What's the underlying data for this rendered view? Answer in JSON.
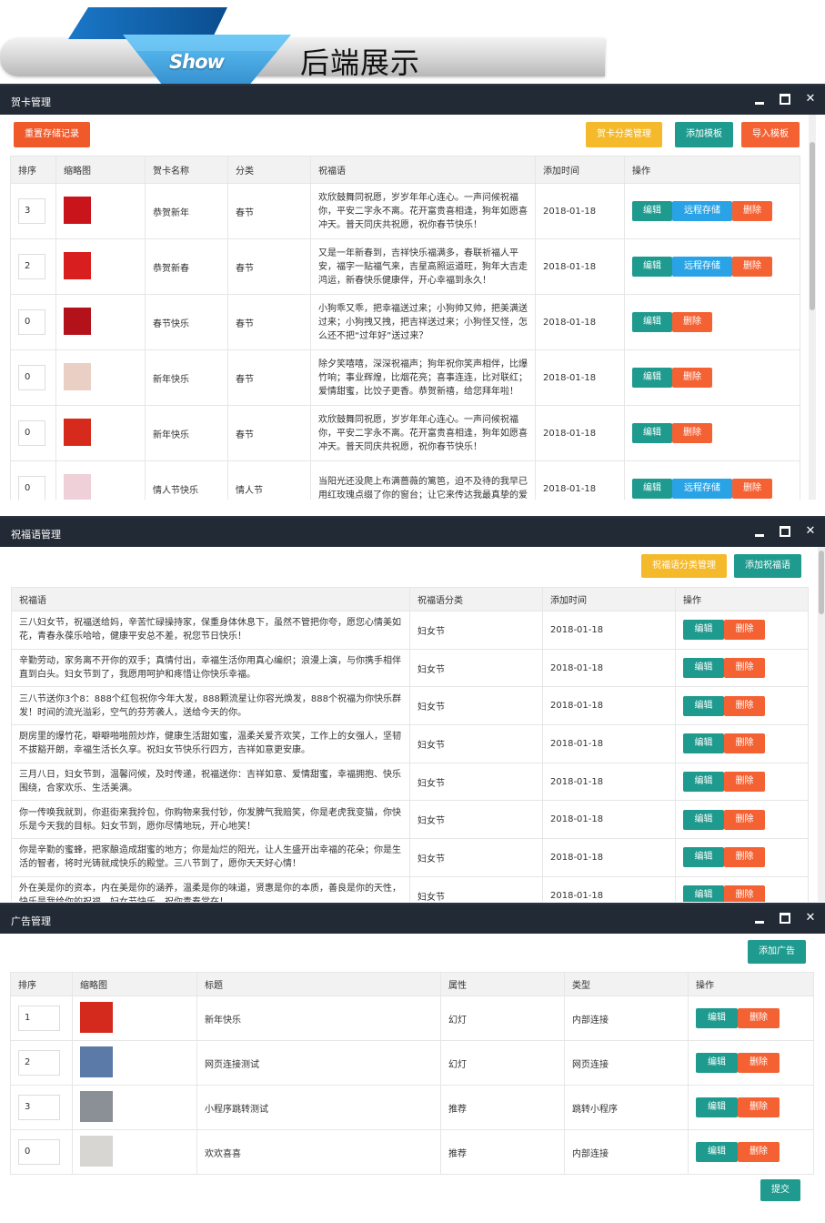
{
  "banner": {
    "show_text": "Show",
    "title": "后端展示"
  },
  "card_panel": {
    "title": "贺卡管理",
    "reset_button": "重置存储记录",
    "category_button": "贺卡分类管理",
    "add_template_button": "添加模板",
    "import_template_button": "导入模板",
    "columns": [
      "排序",
      "缩略图",
      "贺卡名称",
      "分类",
      "祝福语",
      "添加时间",
      "操作"
    ],
    "ops": {
      "edit": "编辑",
      "remote": "远程存储",
      "delete": "删除"
    },
    "rows": [
      {
        "sort": "3",
        "thumb": "#c8141a",
        "name": "恭贺新年",
        "category": "春节",
        "blessing": "欢欣鼓舞同祝愿，岁岁年年心连心。一声问候祝福你，平安二字永不离。花开富贵喜相逢，狗年如愿喜冲天。普天同庆共祝愿，祝你春节快乐！",
        "time": "2018-01-18",
        "remote": true
      },
      {
        "sort": "2",
        "thumb": "#d81e1e",
        "name": "恭贺新春",
        "category": "春节",
        "blessing": "又是一年新春到，吉祥快乐福满多，春联祈福人平安，福字一贴福气来，吉星高照运道旺，狗年大吉走鸿运，新春快乐健康伴，开心幸福到永久！",
        "time": "2018-01-18",
        "remote": true
      },
      {
        "sort": "0",
        "thumb": "#b3121b",
        "name": "春节快乐",
        "category": "春节",
        "blessing": "小狗乖又乖，把幸福送过来；小狗帅又帅，把美满送过来；小狗拽又拽，把吉祥送过来；小狗怪又怪，怎么还不把“过年好”送过来？",
        "time": "2018-01-18",
        "remote": false
      },
      {
        "sort": "0",
        "thumb": "#e9cfc4",
        "name": "新年快乐",
        "category": "春节",
        "blessing": "除夕笑嘻嘻，深深祝福声；狗年祝你笑声相伴，比爆竹响；事业辉煌，比烟花亮；喜事连连，比对联红；爱情甜蜜，比饺子更香。恭贺新禧，给您拜年啦！",
        "time": "2018-01-18",
        "remote": false
      },
      {
        "sort": "0",
        "thumb": "#d62a1c",
        "name": "新年快乐",
        "category": "春节",
        "blessing": "欢欣鼓舞同祝愿，岁岁年年心连心。一声问候祝福你，平安二字永不离。花开富贵喜相逢，狗年如愿喜冲天。普天同庆共祝愿，祝你春节快乐！",
        "time": "2018-01-18",
        "remote": false
      },
      {
        "sort": "0",
        "thumb": "#efd0d8",
        "name": "情人节快乐",
        "category": "情人节",
        "blessing": "当阳光还没爬上布满蔷薇的篱笆，迫不及待的我早已用红玫瑰点缀了你的窗台；让它来传达我最真挚的爱",
        "time": "2018-01-18",
        "remote": true
      }
    ]
  },
  "blessing_panel": {
    "title": "祝福语管理",
    "category_button": "祝福语分类管理",
    "add_button": "添加祝福语",
    "columns": [
      "祝福语",
      "祝福语分类",
      "添加时间",
      "操作"
    ],
    "ops": {
      "edit": "编辑",
      "delete": "删除"
    },
    "rows": [
      {
        "text": "三八妇女节，祝福送给妈，辛苦忙碌操持家，保重身体休息下，虽然不管把你夸，愿您心情美如花，青春永葆乐哈哈，健康平安总不差，祝您节日快乐！",
        "category": "妇女节",
        "time": "2018-01-18"
      },
      {
        "text": "辛勤劳动，家务离不开你的双手；真情付出，幸福生活你用真心编织；浪漫上演，与你携手相伴直到白头。妇女节到了，我愿用呵护和疼惜让你快乐幸福。",
        "category": "妇女节",
        "time": "2018-01-18"
      },
      {
        "text": "三八节送你3个8：888个红包祝你今年大发，888颗流星让你容光焕发，888个祝福为你快乐群发！时间的流光溢彩，空气的芬芳袭人，送给今天的你。",
        "category": "妇女节",
        "time": "2018-01-18"
      },
      {
        "text": "厨房里的爆竹花，噼噼啪啪煎炒炸，健康生活甜如蜜，温柔关爱齐欢笑，工作上的女强人，坚韧不拔豁开朗，幸福生活长久享。祝妇女节快乐行四方，吉祥如意更安康。",
        "category": "妇女节",
        "time": "2018-01-18"
      },
      {
        "text": "三月八日，妇女节到，温馨问候，及时传递，祝福送你：吉祥如意、爱情甜蜜，幸福拥抱、快乐围绕，合家欢乐、生活美满。",
        "category": "妇女节",
        "time": "2018-01-18"
      },
      {
        "text": "你一传唤我就到，你逛街来我拎包，你购物来我付钞，你发脾气我赔笑，你是老虎我变猫，你快乐是今天我的目标。妇女节到，愿你尽情地玩，开心地笑！",
        "category": "妇女节",
        "time": "2018-01-18"
      },
      {
        "text": "你是辛勤的蜜蜂，把家酿造成甜蜜的地方；你是灿烂的阳光，让人生盛开出幸福的花朵；你是生活的智者，将时光铸就成快乐的殿堂。三八节到了，愿你天天好心情！",
        "category": "妇女节",
        "time": "2018-01-18"
      },
      {
        "text": "外在美是你的资本，内在美是你的涵养，温柔是你的味道，贤惠是你的本质，善良是你的天性，快乐是我给你的祝福，妇女节快乐，祝你青春常在！",
        "category": "妇女节",
        "time": "2018-01-18"
      }
    ]
  },
  "ad_panel": {
    "title": "广告管理",
    "add_button": "添加广告",
    "submit_button": "提交",
    "columns": [
      "排序",
      "缩略图",
      "标题",
      "属性",
      "类型",
      "操作"
    ],
    "ops": {
      "edit": "编辑",
      "delete": "删除"
    },
    "rows": [
      {
        "sort": "1",
        "thumb": "#d42a1e",
        "title": "新年快乐",
        "attr": "幻灯",
        "type": "内部连接"
      },
      {
        "sort": "2",
        "thumb": "#5b7aa8",
        "title": "网页连接测试",
        "attr": "幻灯",
        "type": "网页连接"
      },
      {
        "sort": "3",
        "thumb": "#8b8f96",
        "title": "小程序跳转测试",
        "attr": "推荐",
        "type": "跳转小程序"
      },
      {
        "sort": "0",
        "thumb": "#d8d6d2",
        "title": "欢欢喜喜",
        "attr": "推荐",
        "type": "内部连接"
      }
    ]
  }
}
